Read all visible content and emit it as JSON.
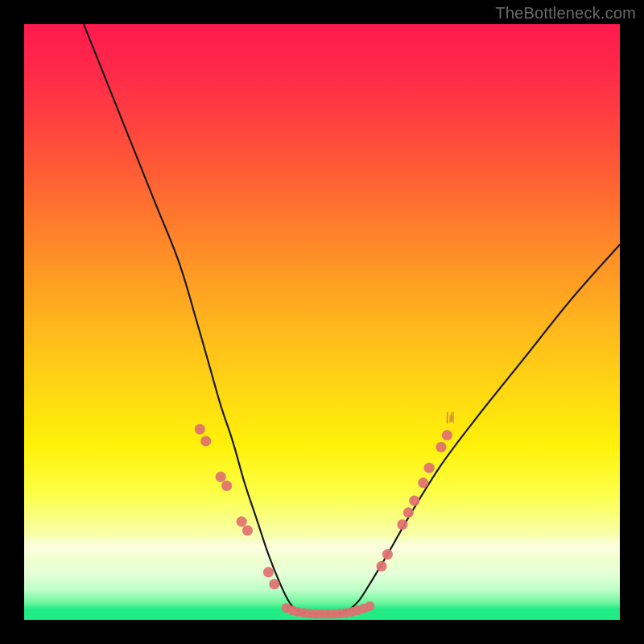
{
  "watermark": "TheBottleneck.com",
  "chart_data": {
    "type": "line",
    "title": "",
    "xlabel": "",
    "ylabel": "",
    "xlim": [
      0,
      100
    ],
    "ylim": [
      0,
      100
    ],
    "grid": false,
    "legend": false,
    "background_gradient": {
      "top_color": "#ff1a4d",
      "mid_color": "#ffe600",
      "bottom_color": "#21ec85",
      "note": "Vertical gradient from hot (top) to cool/green (bottom); y encodes mismatch magnitude"
    },
    "series": [
      {
        "name": "bottleneck-curve",
        "note": "Approximate V-shaped curve; x appears to be a component scale, y is mismatch level (higher = worse). Values estimated from pixel positions.",
        "x": [
          10,
          14,
          18,
          22,
          26,
          29,
          31,
          33,
          35,
          37,
          39,
          41,
          43,
          44.5,
          46,
          48,
          50,
          52,
          54,
          56,
          58,
          61,
          65,
          70,
          76,
          84,
          92,
          100
        ],
        "y": [
          100,
          90,
          80,
          70,
          60,
          50,
          43,
          36,
          30,
          23,
          17,
          11,
          6,
          3,
          1.5,
          1,
          1,
          1,
          1.5,
          3,
          6,
          11,
          18,
          26,
          34,
          44,
          54,
          63
        ]
      },
      {
        "name": "marker-dots-left",
        "note": "Salmon dots on the descending arm",
        "x": [
          29.5,
          30.5,
          33,
          34,
          36.5,
          37.5,
          41,
          42
        ],
        "y": [
          32,
          30,
          24,
          22.5,
          16.5,
          15,
          8,
          6
        ]
      },
      {
        "name": "marker-dots-right",
        "note": "Salmon dots on the ascending arm",
        "x": [
          60,
          61,
          63.5,
          64.5,
          65.5,
          67,
          68,
          70,
          71
        ],
        "y": [
          9,
          11,
          16,
          18,
          20,
          23,
          25.5,
          29,
          31
        ]
      },
      {
        "name": "marker-dots-bottom",
        "note": "Dense salmon band of dots along the flat valley",
        "x": [
          44,
          45,
          46,
          47,
          48,
          49,
          50,
          51,
          52,
          53,
          54,
          55,
          56,
          57,
          58
        ],
        "y": [
          2,
          1.6,
          1.3,
          1.15,
          1.05,
          1,
          1,
          1,
          1,
          1.05,
          1.15,
          1.35,
          1.6,
          1.9,
          2.3
        ]
      }
    ],
    "curve_color": "#1a1a1a",
    "marker_color": "#e07070"
  }
}
